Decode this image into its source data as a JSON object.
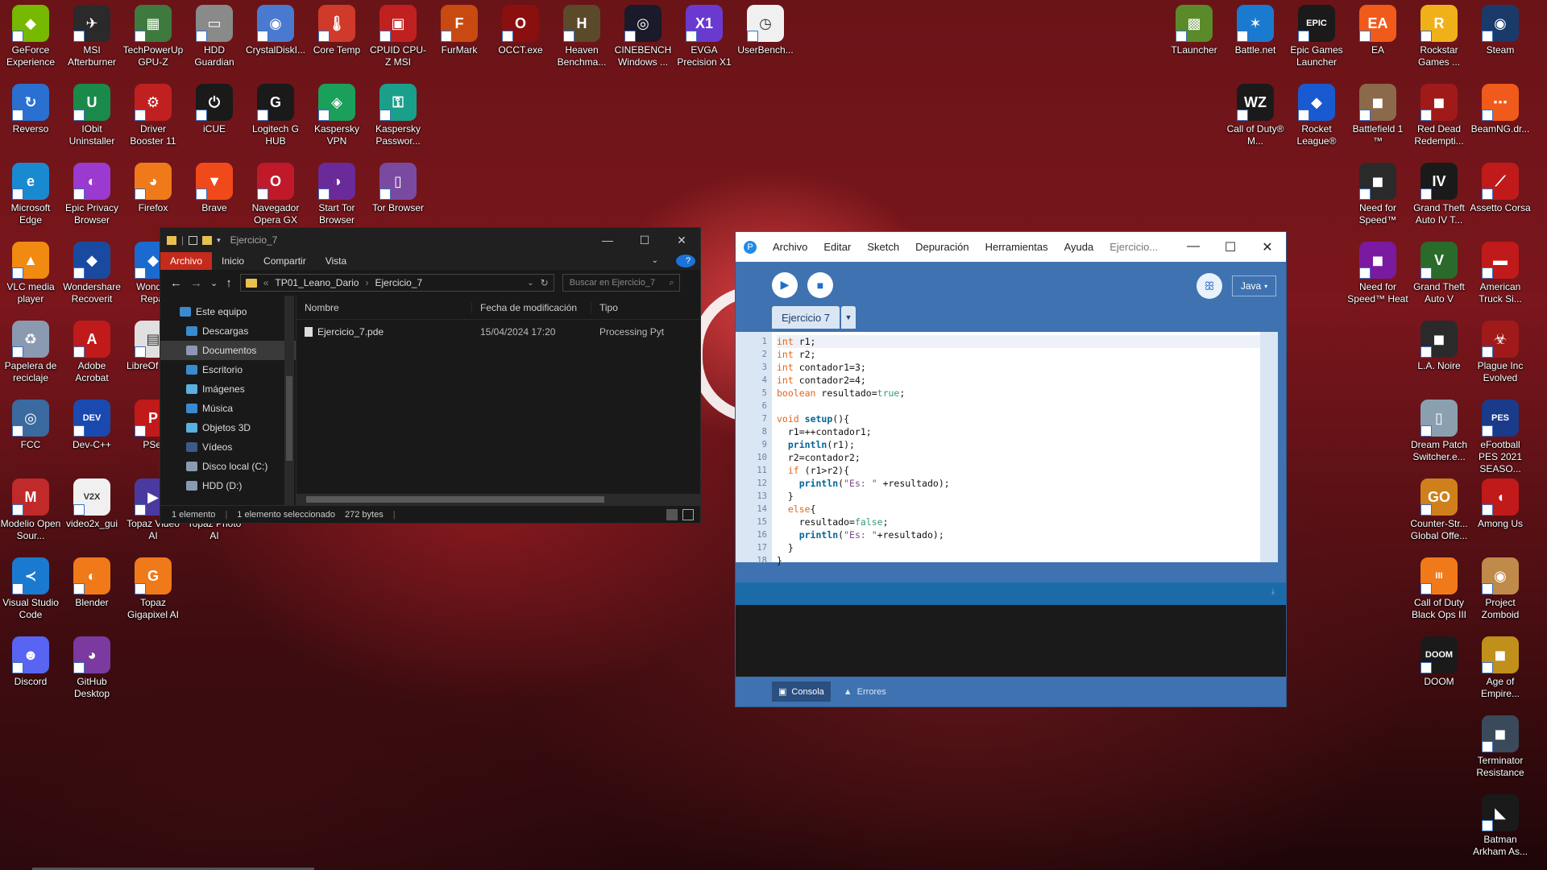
{
  "desktop": {
    "icons": [
      {
        "label": "GeForce Experience",
        "color": "#76b900",
        "glyph": "◆"
      },
      {
        "label": "MSI Afterburner",
        "color": "#2a2a2a",
        "glyph": "✈"
      },
      {
        "label": "TechPowerUp GPU-Z",
        "color": "#3e7a3e",
        "glyph": "▦"
      },
      {
        "label": "HDD Guardian",
        "color": "#8a8a8a",
        "glyph": "▭"
      },
      {
        "label": "CrystalDiskI...",
        "color": "#4a7ad0",
        "glyph": "◉"
      },
      {
        "label": "Core Temp",
        "color": "#d03a2a",
        "glyph": "🌡"
      },
      {
        "label": "CPUID CPU-Z MSI",
        "color": "#c02020",
        "glyph": "▣"
      },
      {
        "label": "FurMark",
        "color": "#c84a10",
        "glyph": "F"
      },
      {
        "label": "OCCT.exe",
        "color": "#8a1010",
        "glyph": "O"
      },
      {
        "label": "Heaven Benchma...",
        "color": "#5a4a2a",
        "glyph": "H"
      },
      {
        "label": "CINEBENCH Windows ...",
        "color": "#1a1a2a",
        "glyph": "◎"
      },
      {
        "label": "EVGA Precision X1",
        "color": "#6a3ad0",
        "glyph": "X1"
      },
      {
        "label": "UserBench...",
        "color": "#f0f0f0",
        "glyph": "◷"
      },
      {
        "label": "Reverso",
        "color": "#2a70d0",
        "glyph": "↻"
      },
      {
        "label": "IObit Uninstaller",
        "color": "#1a8a4a",
        "glyph": "U"
      },
      {
        "label": "Driver Booster 11",
        "color": "#c02020",
        "glyph": "⚙"
      },
      {
        "label": "iCUE",
        "color": "#1a1a1a",
        "glyph": "⏻"
      },
      {
        "label": "Logitech G HUB",
        "color": "#1a1a1a",
        "glyph": "G"
      },
      {
        "label": "Kaspersky VPN",
        "color": "#1aa05a",
        "glyph": "◈"
      },
      {
        "label": "Kaspersky Passwor...",
        "color": "#1aa08a",
        "glyph": "⚿"
      },
      {
        "label": "Microsoft Edge",
        "color": "#1a8ad0",
        "glyph": "e"
      },
      {
        "label": "Epic Privacy Browser",
        "color": "#9a3ad0",
        "glyph": "◐"
      },
      {
        "label": "Firefox",
        "color": "#f07a1a",
        "glyph": "◕"
      },
      {
        "label": "Brave",
        "color": "#f04a1a",
        "glyph": "▼"
      },
      {
        "label": "Navegador Opera GX",
        "color": "#c01a2a",
        "glyph": "O"
      },
      {
        "label": "Start Tor Browser",
        "color": "#6a2a9a",
        "glyph": "◑"
      },
      {
        "label": "Tor Browser",
        "color": "#7a4aa0",
        "glyph": "▯"
      },
      {
        "label": "VLC media player",
        "color": "#f08a10",
        "glyph": "▲"
      },
      {
        "label": "Wondershare Recoverit",
        "color": "#1a4aa0",
        "glyph": "◆"
      },
      {
        "label": "Wonder Repai",
        "color": "#1a6ad0",
        "glyph": "◆"
      },
      {
        "label": "Papelera de reciclaje",
        "color": "#8a9ab0",
        "glyph": "♻"
      },
      {
        "label": "Adobe Acrobat",
        "color": "#c01a1a",
        "glyph": "A"
      },
      {
        "label": "LibreOf 24.2",
        "color": "#e0e0e0",
        "glyph": "▤"
      },
      {
        "label": "FCC",
        "color": "#3a6aa0",
        "glyph": "◎"
      },
      {
        "label": "Dev-C++",
        "color": "#1a4ab0",
        "glyph": "DEV"
      },
      {
        "label": "PSel",
        "color": "#c01a1a",
        "glyph": "P"
      },
      {
        "label": "Modelio Open Sour...",
        "color": "#c02a2a",
        "glyph": "M"
      },
      {
        "label": "video2x_gui",
        "color": "#f0f0f0",
        "glyph": "V2X"
      },
      {
        "label": "Topaz Video AI",
        "color": "#4a3aa0",
        "glyph": "▶"
      },
      {
        "label": "Topaz Photo AI",
        "color": "#3a3a8a",
        "glyph": "◆"
      },
      {
        "label": "Visual Studio Code",
        "color": "#1a7ad0",
        "glyph": "≺"
      },
      {
        "label": "Blender",
        "color": "#f07a1a",
        "glyph": "◐"
      },
      {
        "label": "Topaz Gigapixel AI",
        "color": "#f07a1a",
        "glyph": "G"
      },
      {
        "label": "Discord",
        "color": "#5865f2",
        "glyph": "☻"
      },
      {
        "label": "GitHub Desktop",
        "color": "#7a3aa0",
        "glyph": "◕"
      },
      {
        "label": "TLauncher",
        "color": "#5a8a2a",
        "glyph": "▩"
      },
      {
        "label": "Battle.net",
        "color": "#1a7ad0",
        "glyph": "✶"
      },
      {
        "label": "Epic Games Launcher",
        "color": "#1a1a1a",
        "glyph": "EPIC"
      },
      {
        "label": "EA",
        "color": "#f05a1a",
        "glyph": "EA"
      },
      {
        "label": "Rockstar Games ...",
        "color": "#f0b01a",
        "glyph": "R"
      },
      {
        "label": "Steam",
        "color": "#1a3a6a",
        "glyph": "◉"
      },
      {
        "label": "Call of Duty® M...",
        "color": "#1a1a1a",
        "glyph": "WZ"
      },
      {
        "label": "Rocket League®",
        "color": "#1a5ad0",
        "glyph": "◆"
      },
      {
        "label": "Battlefield 1 ™",
        "color": "#8a6a4a",
        "glyph": "◼"
      },
      {
        "label": "Red Dead Redempti...",
        "color": "#a01a1a",
        "glyph": "◼"
      },
      {
        "label": "BeamNG.dr...",
        "color": "#f05a1a",
        "glyph": "⋯"
      },
      {
        "label": "Need for Speed™",
        "color": "#2a2a2a",
        "glyph": "◼"
      },
      {
        "label": "Grand Theft Auto IV T...",
        "color": "#1a1a1a",
        "glyph": "IV"
      },
      {
        "label": "Assetto Corsa",
        "color": "#c01a1a",
        "glyph": "⟋"
      },
      {
        "label": "Need for Speed™ Heat",
        "color": "#7a1aa0",
        "glyph": "◼"
      },
      {
        "label": "Grand Theft Auto V",
        "color": "#2a6a2a",
        "glyph": "V"
      },
      {
        "label": "American Truck Si...",
        "color": "#c01a1a",
        "glyph": "▬"
      },
      {
        "label": "L.A. Noire",
        "color": "#2a2a2a",
        "glyph": "◼"
      },
      {
        "label": "Plague Inc Evolved",
        "color": "#a01a1a",
        "glyph": "☣"
      },
      {
        "label": "Dream Patch Switcher.e...",
        "color": "#8aa0b0",
        "glyph": "▯"
      },
      {
        "label": "eFootball PES 2021 SEASO...",
        "color": "#1a3a8a",
        "glyph": "PES"
      },
      {
        "label": "Counter-Str... Global Offe...",
        "color": "#d0801a",
        "glyph": "GO"
      },
      {
        "label": "Among Us",
        "color": "#c01a1a",
        "glyph": "◖"
      },
      {
        "label": "Call of Duty Black Ops III",
        "color": "#f07a1a",
        "glyph": "III"
      },
      {
        "label": "Project Zomboid",
        "color": "#c08a4a",
        "glyph": "◉"
      },
      {
        "label": "DOOM",
        "color": "#1a1a1a",
        "glyph": "DOOM"
      },
      {
        "label": "Age of Empire...",
        "color": "#c0901a",
        "glyph": "◼"
      },
      {
        "label": "Terminator Resistance",
        "color": "#3a4a5a",
        "glyph": "◼"
      },
      {
        "label": "Batman Arkham As...",
        "color": "#1a1a1a",
        "glyph": "◣"
      }
    ]
  },
  "explorer": {
    "title": "Ejercicio_7",
    "ribbon": [
      "Archivo",
      "Inicio",
      "Compartir",
      "Vista"
    ],
    "help": "?",
    "nav_back": "←",
    "nav_fwd": "→",
    "nav_down": "⌄",
    "nav_up": "↑",
    "path": [
      "TP01_Leano_Dario",
      "Ejercicio_7"
    ],
    "path_sep": "›",
    "search_placeholder": "Buscar en Ejercicio_7",
    "tree": [
      {
        "label": "Este equipo",
        "color": "#3a8ad0",
        "sel": false,
        "child": false
      },
      {
        "label": "Descargas",
        "color": "#3a8ad0",
        "sel": false,
        "child": true
      },
      {
        "label": "Documentos",
        "color": "#8a9ab0",
        "sel": true,
        "child": true
      },
      {
        "label": "Escritorio",
        "color": "#3a8ad0",
        "sel": false,
        "child": true
      },
      {
        "label": "Imágenes",
        "color": "#5ab0e0",
        "sel": false,
        "child": true
      },
      {
        "label": "Música",
        "color": "#3a8ad0",
        "sel": false,
        "child": true
      },
      {
        "label": "Objetos 3D",
        "color": "#5ab0e0",
        "sel": false,
        "child": true
      },
      {
        "label": "Vídeos",
        "color": "#3a5a8a",
        "sel": false,
        "child": true
      },
      {
        "label": "Disco local (C:)",
        "color": "#8a9ab0",
        "sel": false,
        "child": true
      },
      {
        "label": "HDD (D:)",
        "color": "#8a9ab0",
        "sel": false,
        "child": true
      }
    ],
    "columns": [
      "Nombre",
      "Fecha de modificación",
      "Tipo"
    ],
    "files": [
      {
        "name": "Ejercicio_7.pde",
        "date": "15/04/2024 17:20",
        "type": "Processing Pyt"
      }
    ],
    "status": {
      "count": "1 elemento",
      "selected": "1 elemento seleccionado",
      "size": "272 bytes"
    }
  },
  "processing": {
    "menu": [
      "Archivo",
      "Editar",
      "Sketch",
      "Depuración",
      "Herramientas",
      "Ayuda"
    ],
    "window_title": "Ejercicio...",
    "mode": "Java",
    "tab": "Ejercicio 7",
    "code": [
      "int r1;",
      "int r2;",
      "int contador1=3;",
      "int contador2=4;",
      "boolean resultado=true;",
      "",
      "void setup(){",
      "  r1=++contador1;",
      "  println(r1);",
      "  r2=contador2;",
      "  if (r1>r2){",
      "    println(\"Es: \" +resultado);",
      "  }",
      "  else{",
      "    resultado=false;",
      "    println(\"Es: \"+resultado);",
      "  }",
      "}"
    ],
    "console_tab": "Consola",
    "errors_tab": "Errores"
  }
}
